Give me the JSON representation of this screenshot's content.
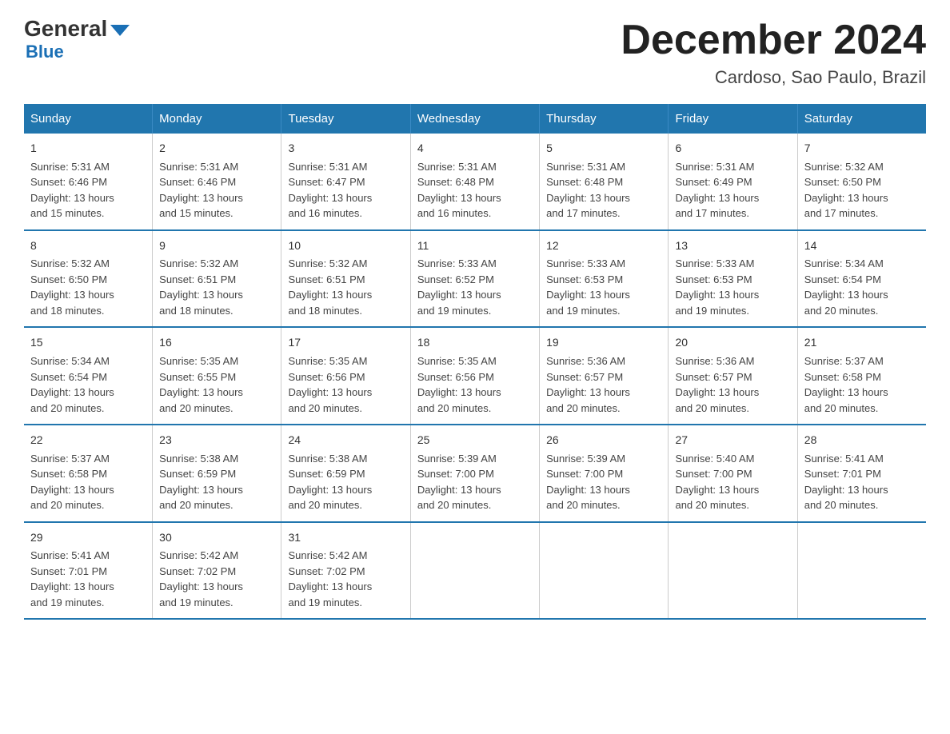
{
  "header": {
    "logo_general": "General",
    "logo_blue": "Blue",
    "month_title": "December 2024",
    "location": "Cardoso, Sao Paulo, Brazil"
  },
  "days_of_week": [
    "Sunday",
    "Monday",
    "Tuesday",
    "Wednesday",
    "Thursday",
    "Friday",
    "Saturday"
  ],
  "weeks": [
    [
      {
        "day": "1",
        "sunrise": "5:31 AM",
        "sunset": "6:46 PM",
        "daylight": "13 hours and 15 minutes."
      },
      {
        "day": "2",
        "sunrise": "5:31 AM",
        "sunset": "6:46 PM",
        "daylight": "13 hours and 15 minutes."
      },
      {
        "day": "3",
        "sunrise": "5:31 AM",
        "sunset": "6:47 PM",
        "daylight": "13 hours and 16 minutes."
      },
      {
        "day": "4",
        "sunrise": "5:31 AM",
        "sunset": "6:48 PM",
        "daylight": "13 hours and 16 minutes."
      },
      {
        "day": "5",
        "sunrise": "5:31 AM",
        "sunset": "6:48 PM",
        "daylight": "13 hours and 17 minutes."
      },
      {
        "day": "6",
        "sunrise": "5:31 AM",
        "sunset": "6:49 PM",
        "daylight": "13 hours and 17 minutes."
      },
      {
        "day": "7",
        "sunrise": "5:32 AM",
        "sunset": "6:50 PM",
        "daylight": "13 hours and 17 minutes."
      }
    ],
    [
      {
        "day": "8",
        "sunrise": "5:32 AM",
        "sunset": "6:50 PM",
        "daylight": "13 hours and 18 minutes."
      },
      {
        "day": "9",
        "sunrise": "5:32 AM",
        "sunset": "6:51 PM",
        "daylight": "13 hours and 18 minutes."
      },
      {
        "day": "10",
        "sunrise": "5:32 AM",
        "sunset": "6:51 PM",
        "daylight": "13 hours and 18 minutes."
      },
      {
        "day": "11",
        "sunrise": "5:33 AM",
        "sunset": "6:52 PM",
        "daylight": "13 hours and 19 minutes."
      },
      {
        "day": "12",
        "sunrise": "5:33 AM",
        "sunset": "6:53 PM",
        "daylight": "13 hours and 19 minutes."
      },
      {
        "day": "13",
        "sunrise": "5:33 AM",
        "sunset": "6:53 PM",
        "daylight": "13 hours and 19 minutes."
      },
      {
        "day": "14",
        "sunrise": "5:34 AM",
        "sunset": "6:54 PM",
        "daylight": "13 hours and 20 minutes."
      }
    ],
    [
      {
        "day": "15",
        "sunrise": "5:34 AM",
        "sunset": "6:54 PM",
        "daylight": "13 hours and 20 minutes."
      },
      {
        "day": "16",
        "sunrise": "5:35 AM",
        "sunset": "6:55 PM",
        "daylight": "13 hours and 20 minutes."
      },
      {
        "day": "17",
        "sunrise": "5:35 AM",
        "sunset": "6:56 PM",
        "daylight": "13 hours and 20 minutes."
      },
      {
        "day": "18",
        "sunrise": "5:35 AM",
        "sunset": "6:56 PM",
        "daylight": "13 hours and 20 minutes."
      },
      {
        "day": "19",
        "sunrise": "5:36 AM",
        "sunset": "6:57 PM",
        "daylight": "13 hours and 20 minutes."
      },
      {
        "day": "20",
        "sunrise": "5:36 AM",
        "sunset": "6:57 PM",
        "daylight": "13 hours and 20 minutes."
      },
      {
        "day": "21",
        "sunrise": "5:37 AM",
        "sunset": "6:58 PM",
        "daylight": "13 hours and 20 minutes."
      }
    ],
    [
      {
        "day": "22",
        "sunrise": "5:37 AM",
        "sunset": "6:58 PM",
        "daylight": "13 hours and 20 minutes."
      },
      {
        "day": "23",
        "sunrise": "5:38 AM",
        "sunset": "6:59 PM",
        "daylight": "13 hours and 20 minutes."
      },
      {
        "day": "24",
        "sunrise": "5:38 AM",
        "sunset": "6:59 PM",
        "daylight": "13 hours and 20 minutes."
      },
      {
        "day": "25",
        "sunrise": "5:39 AM",
        "sunset": "7:00 PM",
        "daylight": "13 hours and 20 minutes."
      },
      {
        "day": "26",
        "sunrise": "5:39 AM",
        "sunset": "7:00 PM",
        "daylight": "13 hours and 20 minutes."
      },
      {
        "day": "27",
        "sunrise": "5:40 AM",
        "sunset": "7:00 PM",
        "daylight": "13 hours and 20 minutes."
      },
      {
        "day": "28",
        "sunrise": "5:41 AM",
        "sunset": "7:01 PM",
        "daylight": "13 hours and 20 minutes."
      }
    ],
    [
      {
        "day": "29",
        "sunrise": "5:41 AM",
        "sunset": "7:01 PM",
        "daylight": "13 hours and 19 minutes."
      },
      {
        "day": "30",
        "sunrise": "5:42 AM",
        "sunset": "7:02 PM",
        "daylight": "13 hours and 19 minutes."
      },
      {
        "day": "31",
        "sunrise": "5:42 AM",
        "sunset": "7:02 PM",
        "daylight": "13 hours and 19 minutes."
      },
      null,
      null,
      null,
      null
    ]
  ],
  "labels": {
    "sunrise": "Sunrise: ",
    "sunset": "Sunset: ",
    "daylight": "Daylight: "
  }
}
